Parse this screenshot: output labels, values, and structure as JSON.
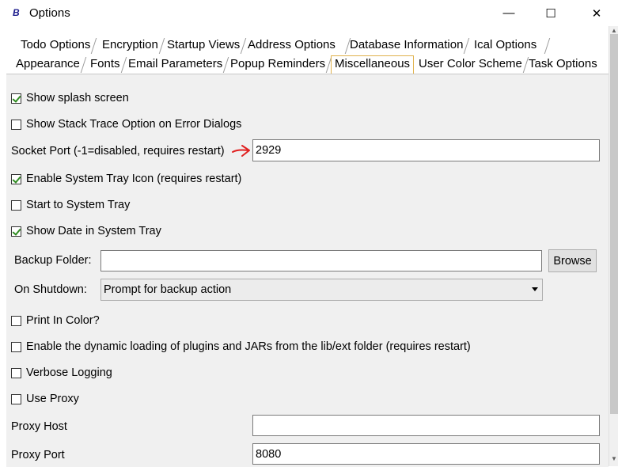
{
  "window": {
    "title": "Options",
    "app_icon_glyph": "B",
    "controls": {
      "minimize": "—",
      "maximize": "☐",
      "close": "✕"
    }
  },
  "tabs": {
    "row1": [
      "Todo Options",
      "Encryption",
      "Startup Views",
      "Address Options",
      "Database Information",
      "Ical Options"
    ],
    "row2": [
      "Appearance",
      "Fonts",
      "Email Parameters",
      "Popup Reminders",
      "Miscellaneous",
      "User Color Scheme",
      "Task Options"
    ],
    "selected": "Miscellaneous"
  },
  "options": {
    "splash": {
      "label": "Show splash screen",
      "checked": true
    },
    "stack_trace": {
      "label": "Show Stack Trace Option on Error Dialogs",
      "checked": false
    },
    "socket_port": {
      "label": "Socket Port (-1=disabled, requires restart)",
      "value": "2929"
    },
    "system_tray_icon": {
      "label": "Enable System Tray Icon (requires restart)",
      "checked": true
    },
    "start_tray": {
      "label": "Start to System Tray",
      "checked": false
    },
    "show_date_tray": {
      "label": "Show Date in System Tray",
      "checked": true
    },
    "backup_folder": {
      "label": "Backup Folder:",
      "value": "",
      "browse_label": "Browse"
    },
    "on_shutdown": {
      "label": "On Shutdown:",
      "selected": "Prompt for backup action"
    },
    "print_color": {
      "label": "Print In Color?",
      "checked": false
    },
    "dynamic_loading": {
      "label": "Enable the dynamic loading of plugins and JARs from the lib/ext folder (requires restart)",
      "checked": false
    },
    "verbose_logging": {
      "label": "Verbose Logging",
      "checked": false
    },
    "use_proxy": {
      "label": "Use Proxy",
      "checked": false
    },
    "proxy_host": {
      "label": "Proxy Host",
      "value": ""
    },
    "proxy_port": {
      "label": "Proxy Port",
      "value": "8080"
    }
  },
  "colors": {
    "selected_tab_border": "#e0b24d",
    "panel_bg": "#f0f0f0",
    "annotation_arrow": "#e02020",
    "checkmark": "#2e8b1f"
  }
}
